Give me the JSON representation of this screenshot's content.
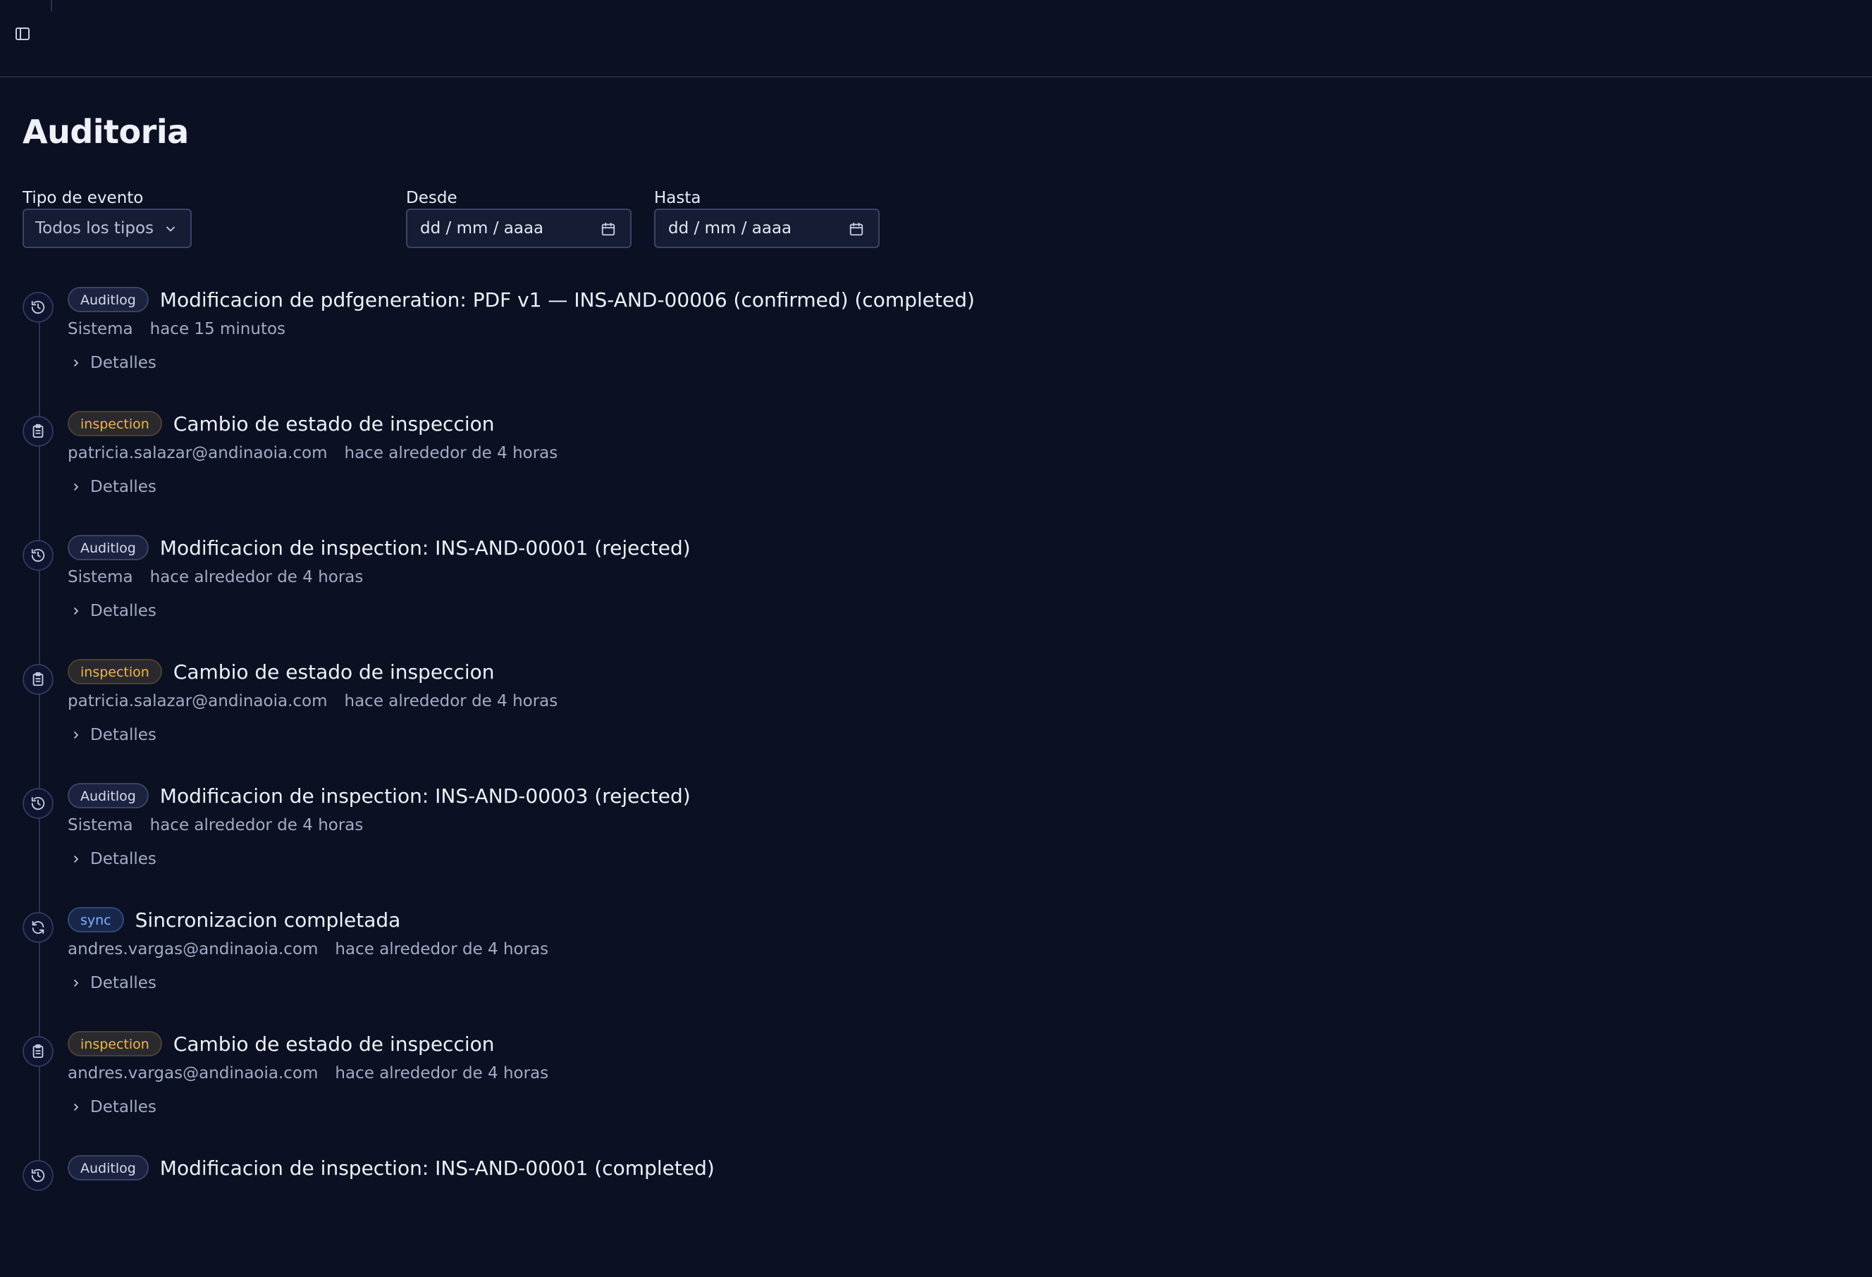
{
  "header": {
    "sidebar_toggle_icon": "panel-left-icon"
  },
  "page": {
    "title": "Auditoria"
  },
  "filters": {
    "event_type_label": "Tipo de evento",
    "event_type_value": "Todos los tipos",
    "from_label": "Desde",
    "from_placeholder": "dd / mm / aaaa",
    "to_label": "Hasta",
    "to_placeholder": "dd / mm / aaaa"
  },
  "details_label": "Detalles",
  "colors": {
    "background": "#0b1022",
    "badge_inspection": "#f0b54a",
    "badge_sync": "#7fb2ff"
  },
  "events": [
    {
      "badge": "Auditlog",
      "kind": "auditlog",
      "icon": "history-icon",
      "title": "Modificacion de pdfgeneration: PDF v1 — INS-AND-00006 (confirmed) (completed)",
      "actor": "Sistema",
      "time": "hace 15 minutos"
    },
    {
      "badge": "inspection",
      "kind": "inspection",
      "icon": "clipboard-icon",
      "title": "Cambio de estado de inspeccion",
      "actor": "patricia.salazar@andinaoia.com",
      "time": "hace alrededor de 4 horas"
    },
    {
      "badge": "Auditlog",
      "kind": "auditlog",
      "icon": "history-icon",
      "title": "Modificacion de inspection: INS-AND-00001 (rejected)",
      "actor": "Sistema",
      "time": "hace alrededor de 4 horas"
    },
    {
      "badge": "inspection",
      "kind": "inspection",
      "icon": "clipboard-icon",
      "title": "Cambio de estado de inspeccion",
      "actor": "patricia.salazar@andinaoia.com",
      "time": "hace alrededor de 4 horas"
    },
    {
      "badge": "Auditlog",
      "kind": "auditlog",
      "icon": "history-icon",
      "title": "Modificacion de inspection: INS-AND-00003 (rejected)",
      "actor": "Sistema",
      "time": "hace alrededor de 4 horas"
    },
    {
      "badge": "sync",
      "kind": "sync",
      "icon": "refresh-icon",
      "title": "Sincronizacion completada",
      "actor": "andres.vargas@andinaoia.com",
      "time": "hace alrededor de 4 horas"
    },
    {
      "badge": "inspection",
      "kind": "inspection",
      "icon": "clipboard-icon",
      "title": "Cambio de estado de inspeccion",
      "actor": "andres.vargas@andinaoia.com",
      "time": "hace alrededor de 4 horas"
    },
    {
      "badge": "Auditlog",
      "kind": "auditlog",
      "icon": "history-icon",
      "title": "Modificacion de inspection: INS-AND-00001 (completed)",
      "actor": "",
      "time": ""
    }
  ]
}
